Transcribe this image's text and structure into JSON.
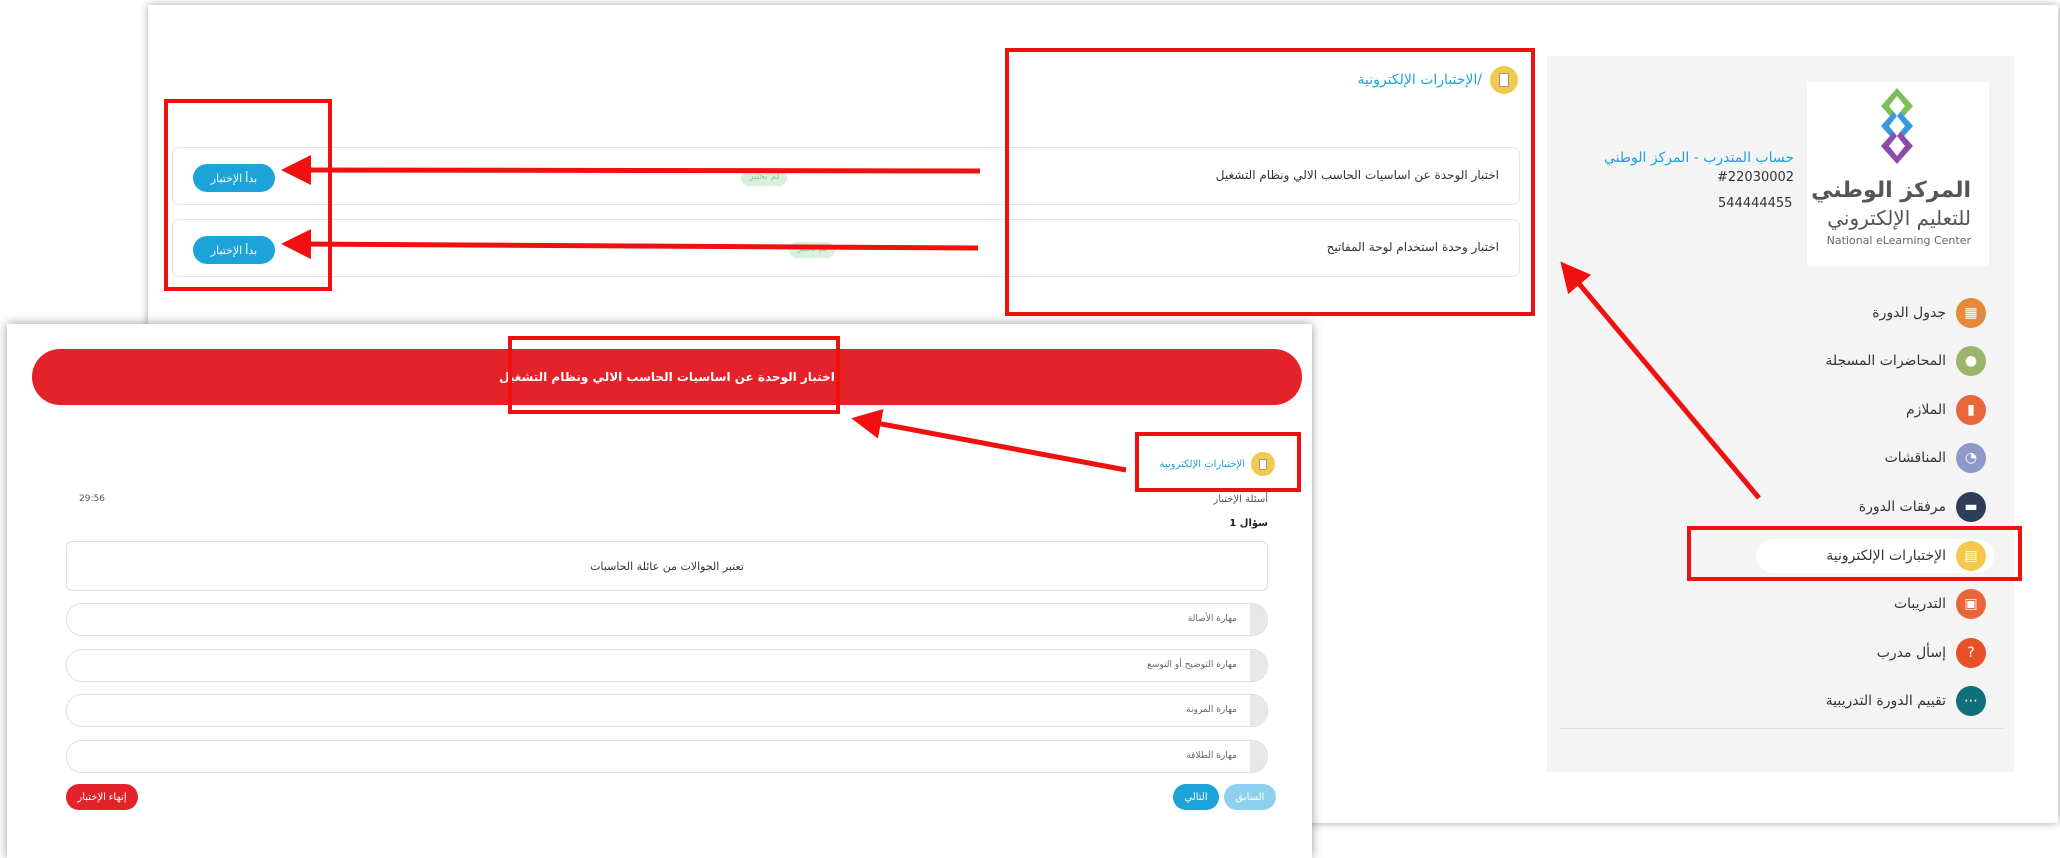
{
  "colors": {
    "accent": "#1ca3d9",
    "danger": "#e32329",
    "annotation": "#f01010"
  },
  "sidebar": {
    "logo": {
      "line1": "المركز الوطني",
      "line2": "للتعليم الإلكتروني",
      "english": "National eLearning Center"
    },
    "account": {
      "name": "حساب المتدرب - المركز الوطني",
      "id": "#22030002",
      "phone": "544444455"
    },
    "items": [
      {
        "label": "جدول الدورة",
        "icon": "calendar-icon",
        "color": "#e8893a"
      },
      {
        "label": "المحاضرات المسجلة",
        "icon": "microphone-icon",
        "color": "#9bb56a"
      },
      {
        "label": "الملازم",
        "icon": "notebook-icon",
        "color": "#e8663a"
      },
      {
        "label": "المناقشات",
        "icon": "chat-bubble-icon",
        "color": "#8e99c9"
      },
      {
        "label": "مرفقات الدورة",
        "icon": "folder-icon",
        "color": "#2e3e5a"
      },
      {
        "label": "الإختبارات الإلكترونية",
        "icon": "exam-icon",
        "color": "#f2c94c",
        "active": true
      },
      {
        "label": "التدريبات",
        "icon": "training-icon",
        "color": "#e8663a"
      },
      {
        "label": "إسأل مدرب",
        "icon": "question-icon",
        "color": "#e8502a"
      },
      {
        "label": "تقييم الدورة التدريبية",
        "icon": "rating-icon",
        "color": "#0f6f7a"
      }
    ]
  },
  "main": {
    "title": "الإختبارات الإلكترونية/",
    "exams": [
      {
        "name": "اختبار الوحدة عن اساسيات الحاسب الالي ونظام التشغيل",
        "status": "لم تختبر",
        "button": "بدأ الإختبار"
      },
      {
        "name": "اختبار وحدة استخدام لوحة المفاتيح",
        "status": "لم تختبر",
        "button": "بدأ الإختبار"
      }
    ]
  },
  "quiz": {
    "banner": "اختبار الوحدة عن اساسيات الحاسب الالي ونظام التشغيل",
    "title": "الإختبارات الإلكترونية",
    "timer": "29:56",
    "questions_heading": "أسئلة الإختبار",
    "question_number": "سؤال 1",
    "question_text": "تعتبر الجوالات من عائلة الحاسبات",
    "options": [
      "مهارة الأصالة",
      "مهارة التوضيح أو التوسع",
      "مهارة المرونة",
      "مهارة الطلاقة"
    ],
    "prev_label": "السابق",
    "next_label": "التالي",
    "end_label": "إنهاء الإختبار"
  }
}
